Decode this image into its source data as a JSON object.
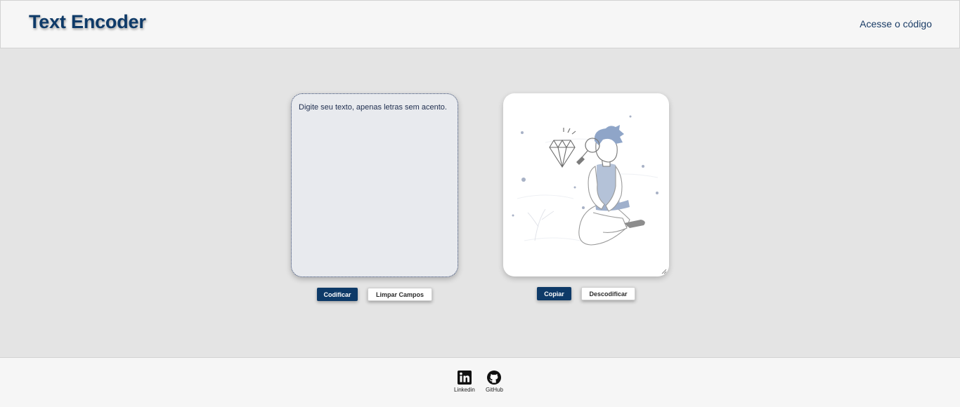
{
  "header": {
    "title": "Text Encoder",
    "code_link": "Acesse o código"
  },
  "encoder": {
    "input_placeholder": "Digite seu texto, apenas letras sem acento.",
    "encode_button": "Codificar",
    "clear_button": "Limpar Campos"
  },
  "output": {
    "illustration_icon": "person-with-magnifier-diamond-illustration",
    "copy_button": "Copiar",
    "decode_button": "Descodificar"
  },
  "footer": {
    "links": [
      {
        "label": "Linkedin",
        "icon": "linkedin-icon"
      },
      {
        "label": "GitHub",
        "icon": "github-icon"
      }
    ]
  },
  "colors": {
    "accent": "#0e3a68",
    "header_bg": "#f6f6f6",
    "page_bg": "#e4e4e4",
    "illustration_blue": "#b4c2d8"
  }
}
